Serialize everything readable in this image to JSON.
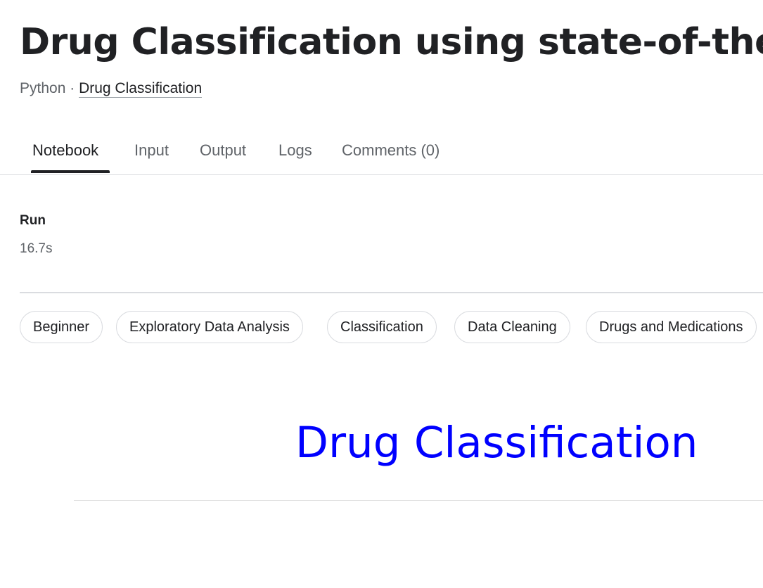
{
  "header": {
    "title": "Drug Classification using state-of-the-art",
    "language": "Python",
    "separator": " · ",
    "dataset_link": "Drug Classification"
  },
  "tabs": [
    {
      "label": "Notebook",
      "active": true
    },
    {
      "label": "Input",
      "active": false
    },
    {
      "label": "Output",
      "active": false
    },
    {
      "label": "Logs",
      "active": false
    },
    {
      "label": "Comments (0)",
      "active": false
    }
  ],
  "run": {
    "label": "Run",
    "value": "16.7s"
  },
  "tags": [
    "Beginner",
    "Exploratory Data Analysis",
    "Classification",
    "Data Cleaning",
    "Drugs and Medications"
  ],
  "notebook": {
    "heading": "Drug Classification",
    "heading_color": "#0000ff"
  }
}
